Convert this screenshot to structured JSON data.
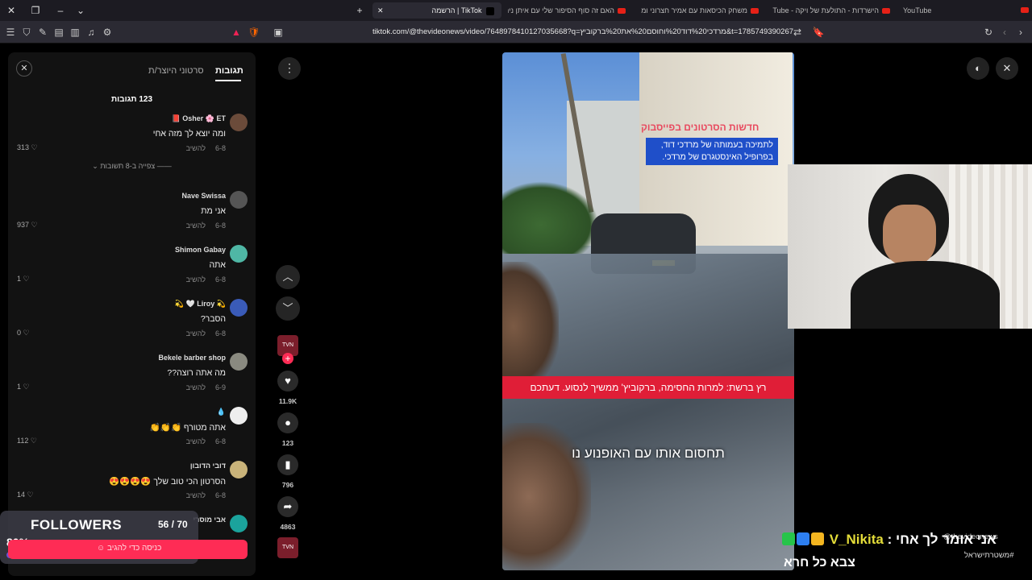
{
  "browser": {
    "tabs": [
      {
        "label": "YouTube",
        "active": false
      },
      {
        "label": "הישרדות - התולעת של ויקה - YouTube",
        "active": false
      },
      {
        "label": "משחק הכיסאות עם אמיר חצרוני ומרו...",
        "active": false
      },
      {
        "label": "האם זה סוף הסיפור שלי עם איתן ניהו...",
        "active": false
      },
      {
        "label": "TikTok | הרשמה",
        "active": true
      }
    ],
    "url": "tiktok.com/@thevideonews/video/7648978410127035668?q=מרדכי%20דוד%20וחוסם%20את%20ברקוביץ&t=1785749390267"
  },
  "comments_panel": {
    "tab_comments": "תגובות",
    "tab_creator_videos": "סרטוני היוצר/ת",
    "count_label": "123 תגובות",
    "reply_label": "להשיב",
    "view_replies": "צפייה ב-8 תשובות",
    "comments": [
      {
        "user": "Osher 🌸 ET 📕",
        "text": "ומה יוצא לך מזה אחי",
        "date": "6-8",
        "likes": "313"
      },
      {
        "user": "Nave Swissa",
        "text": "אני מת",
        "date": "6-8",
        "likes": "937"
      },
      {
        "user": "Shimon Gabay",
        "text": "אתה",
        "date": "6-8",
        "likes": "1"
      },
      {
        "user": "💫 Liroy 🤍 💫",
        "text": "הסבר?",
        "date": "6-8",
        "likes": "0"
      },
      {
        "user": "Bekele barber shop",
        "text": "מה אתה רוצה??",
        "date": "6-9",
        "likes": "1"
      },
      {
        "user": "💧",
        "text": "אתה מטורף 👏👏👏",
        "date": "6-8",
        "likes": "112"
      },
      {
        "user": "דובי הדובון",
        "text": "הסרטון הכי טוב שלך 😍😍😍😍",
        "date": "6-8",
        "likes": "14"
      },
      {
        "user": "אבי מוסרי",
        "text": "",
        "date": "",
        "likes": ""
      }
    ],
    "post_placeholder": "כניסה כדי להגיב"
  },
  "followers_goal": {
    "title": "FOLLOWERS",
    "count": "56 / 70",
    "percent_label": "80%",
    "progress": 0.8
  },
  "actions": {
    "likes": "11.9K",
    "comments": "123",
    "saves": "796",
    "shares": "4863"
  },
  "video": {
    "caption_red": "חדשות הסרטונים בפייסבוק",
    "caption_blue_1": "לתמיכה בעמותה של מרדכי דוד,",
    "caption_blue_2": "בפרופיל האינסטגרם של מרדכי.",
    "banner": "רץ ברשת: למרות החסימה, ברקוביץ' ממשיך לנסוע. דעתכם",
    "subtitle": "תחסום אותו עם האופנוע נו"
  },
  "stream_overlay": {
    "chat_user": "V_Nikita",
    "chat_message": "אני אומר לך אחי",
    "chat_message_2": "צבא כל חרא",
    "handle": "@thevideonews",
    "hashtag": "#משטרתישראל"
  },
  "colors": {
    "tiktok_red": "#fe2c55",
    "progress_purple": "#6b4ed8",
    "chat_user_yellow": "#e3dc39",
    "banner_red": "#e01e37",
    "caption_blue": "#1f4fc9"
  }
}
